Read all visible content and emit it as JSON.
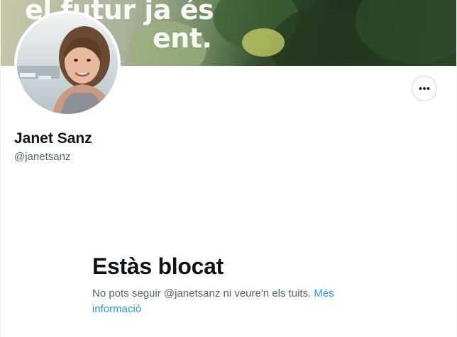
{
  "banner": {
    "text_line1": "el futur ja és",
    "text_line2": "ent."
  },
  "profile": {
    "display_name": "Janet Sanz",
    "handle": "@janetsanz",
    "more_icon": "more-horizontal-icon"
  },
  "blocked": {
    "title": "Estàs blocat",
    "description": "No pots seguir @janetsanz ni veure'n els tuits.",
    "link_label": "Més informació"
  },
  "colors": {
    "primary_text": "#0f1419",
    "secondary_text": "#536471",
    "link": "#1d9bf0",
    "border": "#cfd9de"
  }
}
